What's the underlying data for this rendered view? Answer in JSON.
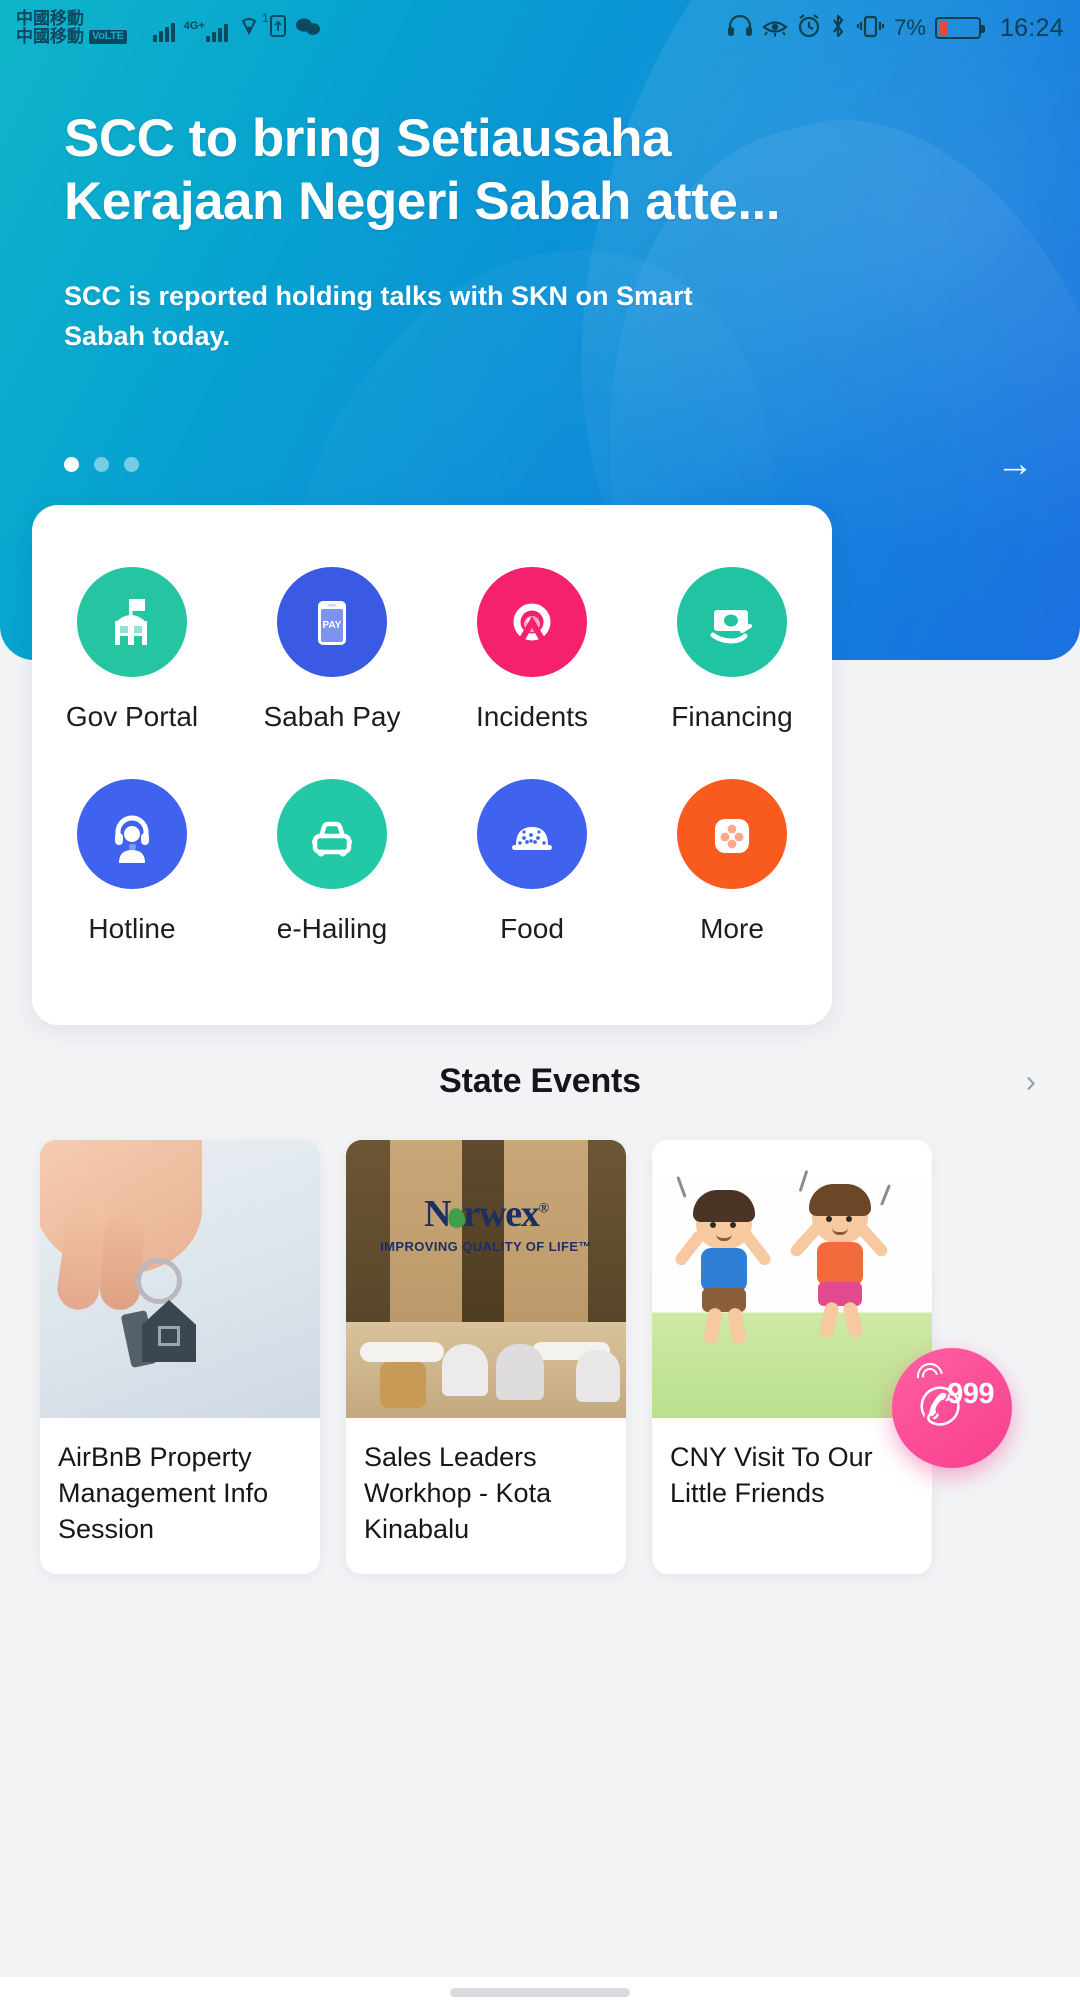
{
  "status_bar": {
    "carrier_line1": "中國移動",
    "carrier_line2": "中國移動",
    "volte_badge": "VoLTE",
    "network_label": "4G+",
    "sim_superscript": "1",
    "battery_percent": "7%",
    "time": "16:24",
    "icons": [
      "signal-bars-icon",
      "network-4g-icon",
      "hotspot-icon",
      "sim-card-icon",
      "wechat-icon",
      "headphones-icon",
      "eye-comfort-icon",
      "alarm-clock-icon",
      "bluetooth-icon",
      "vibrate-icon",
      "battery-icon"
    ]
  },
  "hero": {
    "title": "SCC to bring Setiausaha Kerajaan Negeri Sabah atte...",
    "subtitle": "SCC is reported holding talks with SKN on Smart Sabah today.",
    "dots_total": 3,
    "active_dot": 1,
    "next_arrow": "→",
    "bg_color_start": "#0fb5c9",
    "bg_color_end": "#1a6fe0"
  },
  "services": {
    "row1": [
      {
        "label": "Gov Portal",
        "icon": "government-building-icon",
        "color": "#25c5a2"
      },
      {
        "label": "Sabah Pay",
        "icon": "mobile-pay-icon",
        "color": "#3b5ae4",
        "badge_text": "PAY"
      },
      {
        "label": "Incidents",
        "icon": "incident-alert-icon",
        "color": "#f5206e"
      },
      {
        "label": "Financing",
        "icon": "money-hand-icon",
        "color": "#20c4a3"
      }
    ],
    "row2": [
      {
        "label": "Hotline",
        "icon": "headset-support-icon",
        "color": "#3f63ef"
      },
      {
        "label": "e-Hailing",
        "icon": "car-icon",
        "color": "#23c9a7"
      },
      {
        "label": "Food",
        "icon": "rice-bowl-icon",
        "color": "#3f63ef"
      },
      {
        "label": "More",
        "icon": "more-grid-icon",
        "color": "#f95b1f"
      }
    ]
  },
  "state_events": {
    "title": "State Events",
    "more_arrow": "›",
    "cards": [
      {
        "title": "AirBnB Property Management Info Session",
        "image": "keys-in-hand-photo"
      },
      {
        "title": "Sales Leaders Workhop - Kota Kinabalu",
        "image": "norwex-booth-photo"
      },
      {
        "title": "CNY Visit To Our Little Friends",
        "image": "children-jumping-illustration"
      }
    ]
  },
  "emergency_fab": {
    "number": "999",
    "icon": "phone-call-icon",
    "color": "#f83f8f"
  }
}
